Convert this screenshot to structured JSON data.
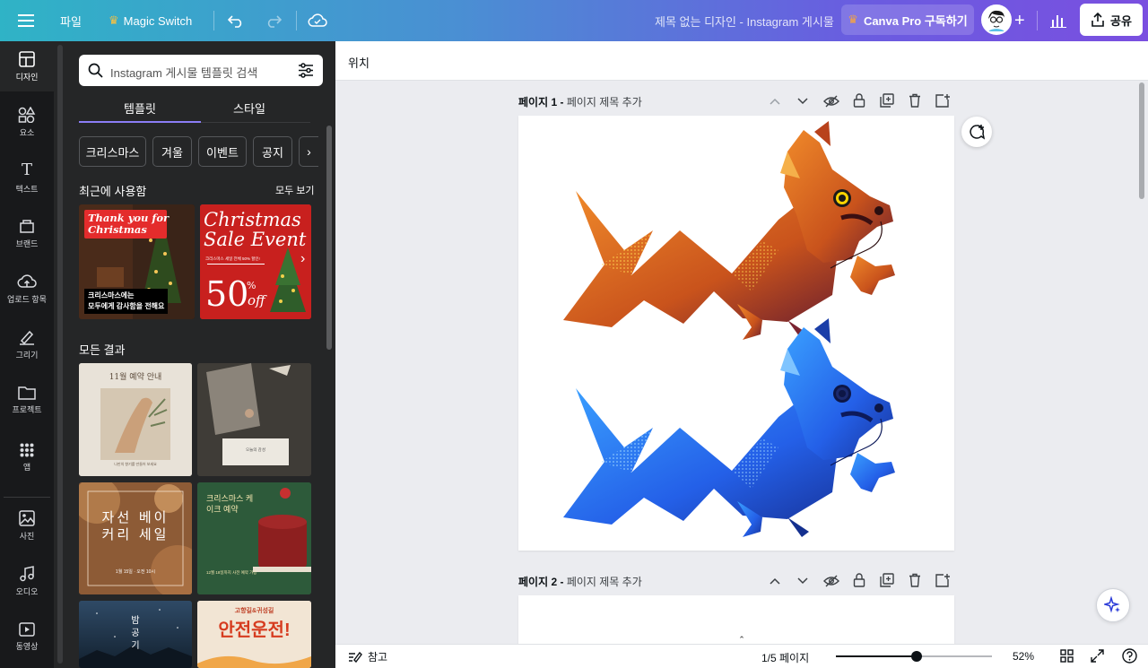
{
  "topbar": {
    "file_label": "파일",
    "magic_switch_label": "Magic Switch",
    "doc_title": "제목 없는 디자인 - Instagram 게시물",
    "pro_label": "Canva Pro 구독하기",
    "share_label": "공유"
  },
  "rail": {
    "items": [
      {
        "label": "디자인",
        "icon": "design-icon"
      },
      {
        "label": "요소",
        "icon": "elements-icon"
      },
      {
        "label": "텍스트",
        "icon": "text-icon"
      },
      {
        "label": "브랜드",
        "icon": "brand-icon"
      },
      {
        "label": "업로드 항목",
        "icon": "upload-icon"
      },
      {
        "label": "그리기",
        "icon": "draw-icon"
      },
      {
        "label": "프로젝트",
        "icon": "folder-icon"
      },
      {
        "label": "앱",
        "icon": "apps-icon"
      },
      {
        "label": "사진",
        "icon": "photo-icon"
      },
      {
        "label": "오디오",
        "icon": "audio-icon"
      },
      {
        "label": "동영상",
        "icon": "video-icon"
      }
    ]
  },
  "panel": {
    "search_placeholder": "Instagram 게시물 템플릿 검색",
    "tabs": [
      "템플릿",
      "스타일"
    ],
    "chips": [
      "크리스마스",
      "겨울",
      "이벤트",
      "공지"
    ],
    "recent_title": "최근에 사용함",
    "see_all": "모두 보기",
    "all_results_title": "모든 결과",
    "recent_templates": [
      {
        "line1": "Thank you for",
        "line2": "Christmas",
        "caption1": "크리스마스에는",
        "caption2": "모두에게 감사함을 전해요"
      },
      {
        "line1": "Christmas",
        "line2": "Sale Event",
        "big": "50",
        "pct": "%",
        "off": "off",
        "small": "크리스마스 세일 전체 50% 할인!"
      }
    ],
    "results": [
      {
        "title": "11월 예약 안내",
        "sub": "나만의 향기를 만들어 보세요"
      },
      {
        "title": "",
        "sub": "오늘의 감성"
      },
      {
        "title": "자선 베이커리 세일",
        "sub": "1월 15일 · 오전 10시"
      },
      {
        "title": "크리스마스 케이크 예약",
        "sub": "12월 18일까지 사전 예약 가능"
      },
      {
        "title": "밤 공기",
        "sub": ""
      },
      {
        "title": "안전운전!",
        "sub": "고향길&귀성길"
      }
    ]
  },
  "canvas": {
    "position_label": "위치",
    "page1_label": "페이지 1 -",
    "page1_title": "페이지 제목 추가",
    "page2_label": "페이지 2 -",
    "page2_title": "페이지 제목 추가"
  },
  "footer": {
    "notes_label": "참고",
    "page_indicator": "1/5 페이지",
    "zoom_value": "52%",
    "zoom_fraction": 0.52
  },
  "colors": {
    "topbar_start": "#2fb3c6",
    "topbar_end": "#7a4fe0",
    "dragon_orange": "#d9641f",
    "dragon_blue": "#2d6ff0",
    "panel_bg": "#252627",
    "accent": "#8b7df5"
  }
}
